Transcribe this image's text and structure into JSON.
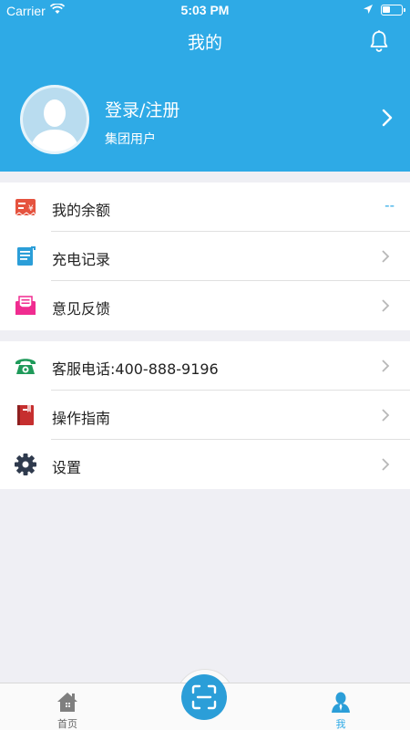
{
  "status_bar": {
    "carrier": "Carrier",
    "time": "5:03 PM"
  },
  "nav": {
    "title": "我的",
    "bell_icon": "bell-icon"
  },
  "profile": {
    "name": "登录/注册",
    "subtitle": "集团用户"
  },
  "menu_section_1": [
    {
      "label": "我的余额",
      "icon": "balance-icon",
      "value": "--",
      "color": "#e5533f"
    },
    {
      "label": "充电记录",
      "icon": "charge-record-icon",
      "color": "#2b9ed8"
    },
    {
      "label": "意见反馈",
      "icon": "feedback-icon",
      "color": "#f02c90"
    }
  ],
  "menu_section_2": [
    {
      "label": "客服电话:400-888-9196",
      "icon": "phone-icon",
      "color": "#1f9a5a"
    },
    {
      "label": "操作指南",
      "icon": "guide-book-icon",
      "color": "#c62f2f"
    },
    {
      "label": "设置",
      "icon": "gear-icon",
      "color": "#2f3a4d"
    }
  ],
  "tabbar": {
    "home_label": "首页",
    "me_label": "我",
    "scan_icon": "scan-icon",
    "active_tab": "我"
  },
  "colors": {
    "brand": "#2eaae6",
    "background": "#efeff4"
  }
}
